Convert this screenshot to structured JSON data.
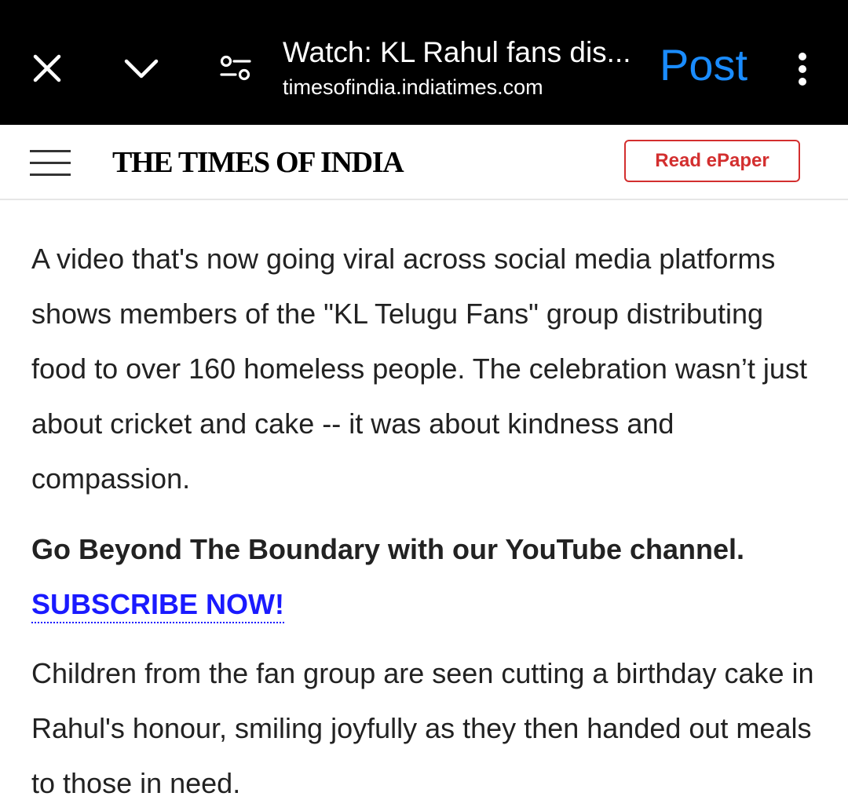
{
  "browser_bar": {
    "title": "Watch: KL Rahul fans dis...",
    "url": "timesofindia.indiatimes.com",
    "post_label": "Post",
    "icons": [
      "close-icon",
      "chevron-down-icon",
      "tune-icon",
      "more-vert-icon"
    ]
  },
  "site_header": {
    "logo_text": "THE TIMES OF INDIA",
    "epaper_label": "Read ePaper",
    "accent_color": "#d32f2f"
  },
  "article": {
    "paragraph_1": "A video that's now going viral across social media platforms shows members of the \"KL Telugu Fans\" group distributing food to over 160 homeless people. The celebration wasn’t just about cricket and cake -- it was about kindness and compassion.",
    "cta_text": "Go Beyond The Boundary with our YouTube channel.",
    "cta_link": "SUBSCRIBE NOW!",
    "paragraph_2": "Children from the fan group are seen cutting a birthday cake in Rahul's honour, smiling joyfully as they then handed out meals to those in need."
  },
  "colors": {
    "post_blue": "#1a8cff",
    "link_blue": "#1a1aff"
  }
}
